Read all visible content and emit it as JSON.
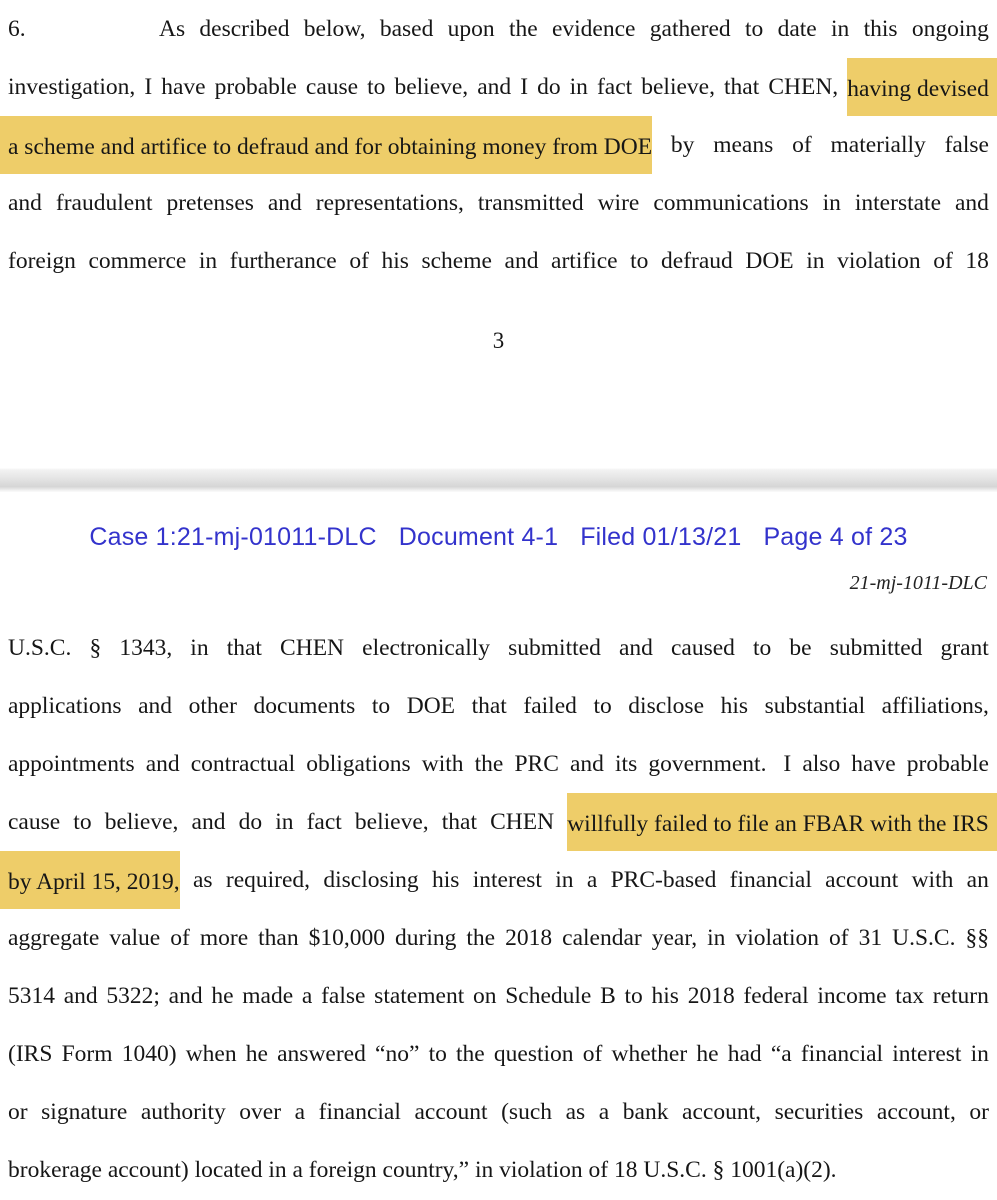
{
  "document": {
    "type": "court-filing-pdf-page",
    "highlight_color": "#eecd69",
    "header_link_color": "#3333cc"
  },
  "page_top": {
    "paragraph_number": "6.",
    "lines": [
      {
        "id": "l1",
        "words": [
          "As",
          "described",
          "below,",
          "based",
          "upon",
          "the",
          "evidence",
          "gathered",
          "to",
          "date",
          "in",
          "this",
          "ongoing"
        ]
      },
      {
        "id": "l2",
        "plain_words": [
          "investigation,",
          "I",
          "have",
          "probable",
          "cause",
          "to",
          "believe,",
          "and",
          "I",
          "do",
          "in",
          "fact",
          "believe,",
          "that",
          "CHEN,"
        ],
        "highlighted_tail": "having devised"
      },
      {
        "id": "l3",
        "highlighted_head": "a scheme and artifice to defraud and for obtaining money from DOE",
        "plain_words": [
          "by",
          "means",
          "of",
          "materially",
          "false"
        ]
      },
      {
        "id": "l4",
        "words": [
          "and",
          "fraudulent",
          "pretenses",
          "and",
          "representations,",
          "transmitted",
          "wire",
          "communications",
          "in",
          "interstate",
          "and"
        ]
      },
      {
        "id": "l5",
        "words": [
          "foreign",
          "commerce",
          "in",
          "furtherance",
          "of",
          "his",
          "scheme",
          "and",
          "artifice",
          "to",
          "defraud",
          "DOE",
          "in",
          "violation",
          "of",
          "18"
        ]
      }
    ],
    "page_number": "3"
  },
  "page_bottom": {
    "ecf_header": {
      "case": "Case 1:21-mj-01011-DLC",
      "document": "Document 4-1",
      "filed": "Filed 01/13/21",
      "page": "Page 4 of 23"
    },
    "caption_right": "21-mj-1011-DLC",
    "lines": [
      {
        "id": "b1",
        "words": [
          "U.S.C.",
          "§",
          "1343,",
          "in",
          "that",
          "CHEN",
          "electronically",
          "submitted",
          "and",
          "caused",
          "to",
          "be",
          "submitted",
          "grant"
        ]
      },
      {
        "id": "b2",
        "words": [
          "applications",
          "and",
          "other",
          "documents",
          "to",
          "DOE",
          "that",
          "failed",
          "to",
          "disclose",
          "his",
          "substantial",
          "affiliations,"
        ]
      },
      {
        "id": "b3",
        "words": [
          "appointments",
          "and",
          "contractual",
          "obligations",
          "with",
          "the",
          "PRC",
          "and",
          "its",
          "government.",
          " I",
          "also",
          "have",
          "probable"
        ]
      },
      {
        "id": "b4",
        "plain_words": [
          "cause",
          "to",
          "believe,",
          "and",
          "do",
          "in",
          "fact",
          "believe,",
          "that",
          "CHEN"
        ],
        "highlighted_tail": "willfully failed to file an FBAR with the IRS"
      },
      {
        "id": "b5",
        "highlighted_head": "by April 15, 2019,",
        "plain_words": [
          "as",
          "required,",
          "disclosing",
          "his",
          "interest",
          "in",
          "a",
          "PRC-based",
          "financial",
          "account",
          "with",
          "an"
        ]
      },
      {
        "id": "b6",
        "words": [
          "aggregate",
          "value",
          "of",
          "more",
          "than",
          "$10,000",
          "during",
          "the",
          "2018",
          "calendar",
          "year,",
          "in",
          "violation",
          "of",
          "31",
          "U.S.C.",
          "§§"
        ]
      },
      {
        "id": "b7",
        "words": [
          "5314",
          "and",
          "5322;",
          "and",
          "he",
          "made",
          "a",
          "false",
          "statement",
          "on",
          "Schedule",
          "B",
          "to",
          "his",
          "2018",
          "federal",
          "income",
          "tax",
          "return"
        ]
      },
      {
        "id": "b8",
        "words": [
          "(IRS",
          "Form",
          "1040)",
          "when",
          "he",
          "answered",
          "“no”",
          "to",
          "the",
          "question",
          "of",
          "whether",
          "he",
          "had",
          "“a",
          "financial",
          "interest",
          "in"
        ]
      },
      {
        "id": "b9",
        "words": [
          "or",
          "signature",
          "authority",
          "over",
          "a",
          "financial",
          "account",
          "(such",
          "as",
          "a",
          "bank",
          "account,",
          "securities",
          "account,",
          "or"
        ]
      },
      {
        "id": "b10",
        "last": true,
        "text": "brokerage account) located in a foreign country,” in violation of 18 U.S.C. § 1001(a)(2)."
      }
    ]
  }
}
